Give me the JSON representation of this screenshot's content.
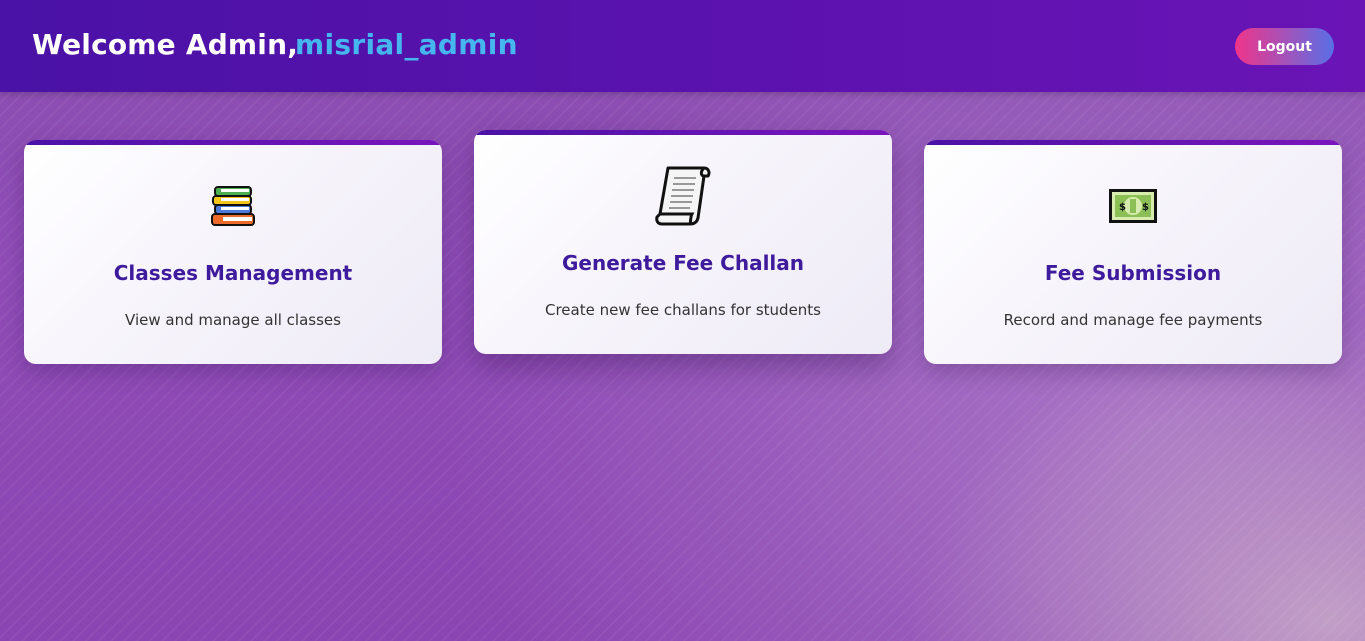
{
  "header": {
    "welcome_text": "Welcome Admin,",
    "username": "misrial_admin",
    "logout_label": "Logout"
  },
  "cards": [
    {
      "icon": "books-icon",
      "title": "Classes Management",
      "description": "View and manage all classes"
    },
    {
      "icon": "scroll-icon",
      "title": "Generate Fee Challan",
      "description": "Create new fee challans for students"
    },
    {
      "icon": "banknote-icon",
      "title": "Fee Submission",
      "description": "Record and manage fee payments"
    }
  ],
  "colors": {
    "header_start": "#4a12a6",
    "header_end": "#6a14b6",
    "username": "#45b6ee",
    "card_title": "#3e1a9c",
    "logout_start": "#f0358a",
    "logout_end": "#5a6fe6"
  }
}
